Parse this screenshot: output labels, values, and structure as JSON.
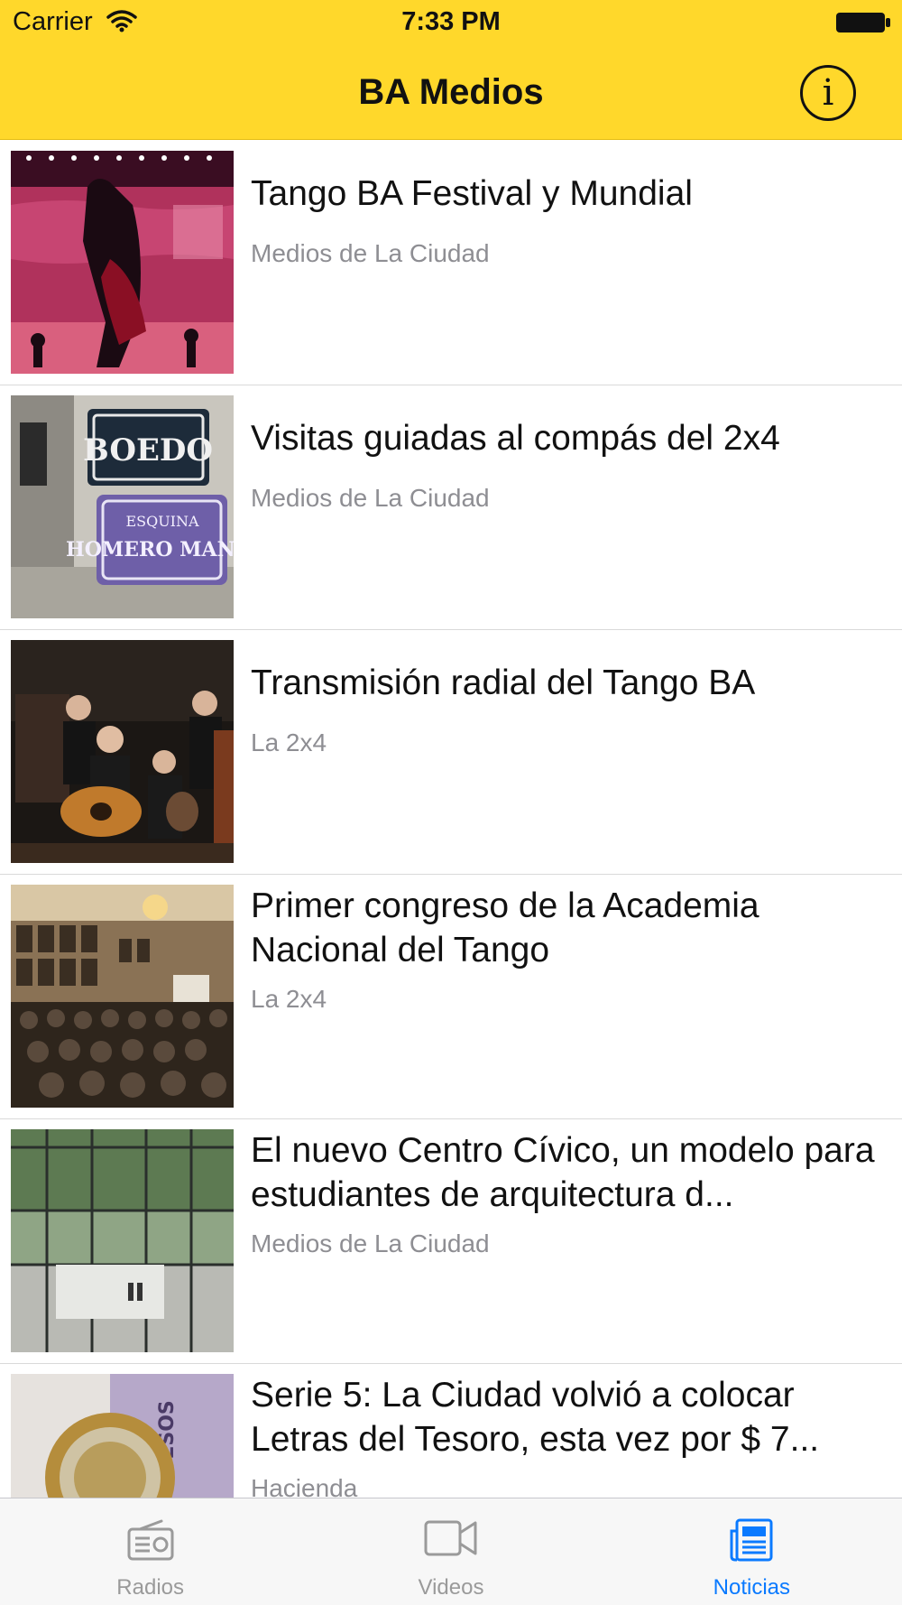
{
  "status_bar": {
    "carrier": "Carrier",
    "time": "7:33 PM"
  },
  "nav": {
    "title": "BA Medios",
    "info_icon": "info-circle-icon"
  },
  "news": [
    {
      "title": "Tango BA Festival y Mundial",
      "source": "Medios de La Ciudad",
      "image": "tango-dancers-photo"
    },
    {
      "title": "Visitas guiadas al compás del 2x4",
      "source": "Medios de La Ciudad",
      "image": "street-sign-photo"
    },
    {
      "title": "Transmisión radial del Tango BA",
      "source": "La 2x4",
      "image": "tango-musicians-photo"
    },
    {
      "title": "Primer congreso de la Academia Nacional del Tango",
      "source": "La 2x4",
      "image": "academy-hall-photo"
    },
    {
      "title": "El nuevo Centro Cívico, un modelo para estudiantes de arquitectura d...",
      "source": "Medios de La Ciudad",
      "image": "civic-center-photo"
    },
    {
      "title": "Serie 5: La Ciudad volvió a colocar Letras del Tesoro, esta vez por $ 7...",
      "source": "Hacienda",
      "image": "coins-banknote-photo"
    }
  ],
  "tabs": [
    {
      "label": "Radios",
      "icon": "radio-icon",
      "active": false
    },
    {
      "label": "Videos",
      "icon": "video-camera-icon",
      "active": false
    },
    {
      "label": "Noticias",
      "icon": "newspaper-icon",
      "active": true
    }
  ],
  "colors": {
    "nav_background": "#FFD82B",
    "tab_active": "#0a7aff",
    "tab_inactive": "#9a9a9a",
    "source_text": "#8e8e93"
  }
}
